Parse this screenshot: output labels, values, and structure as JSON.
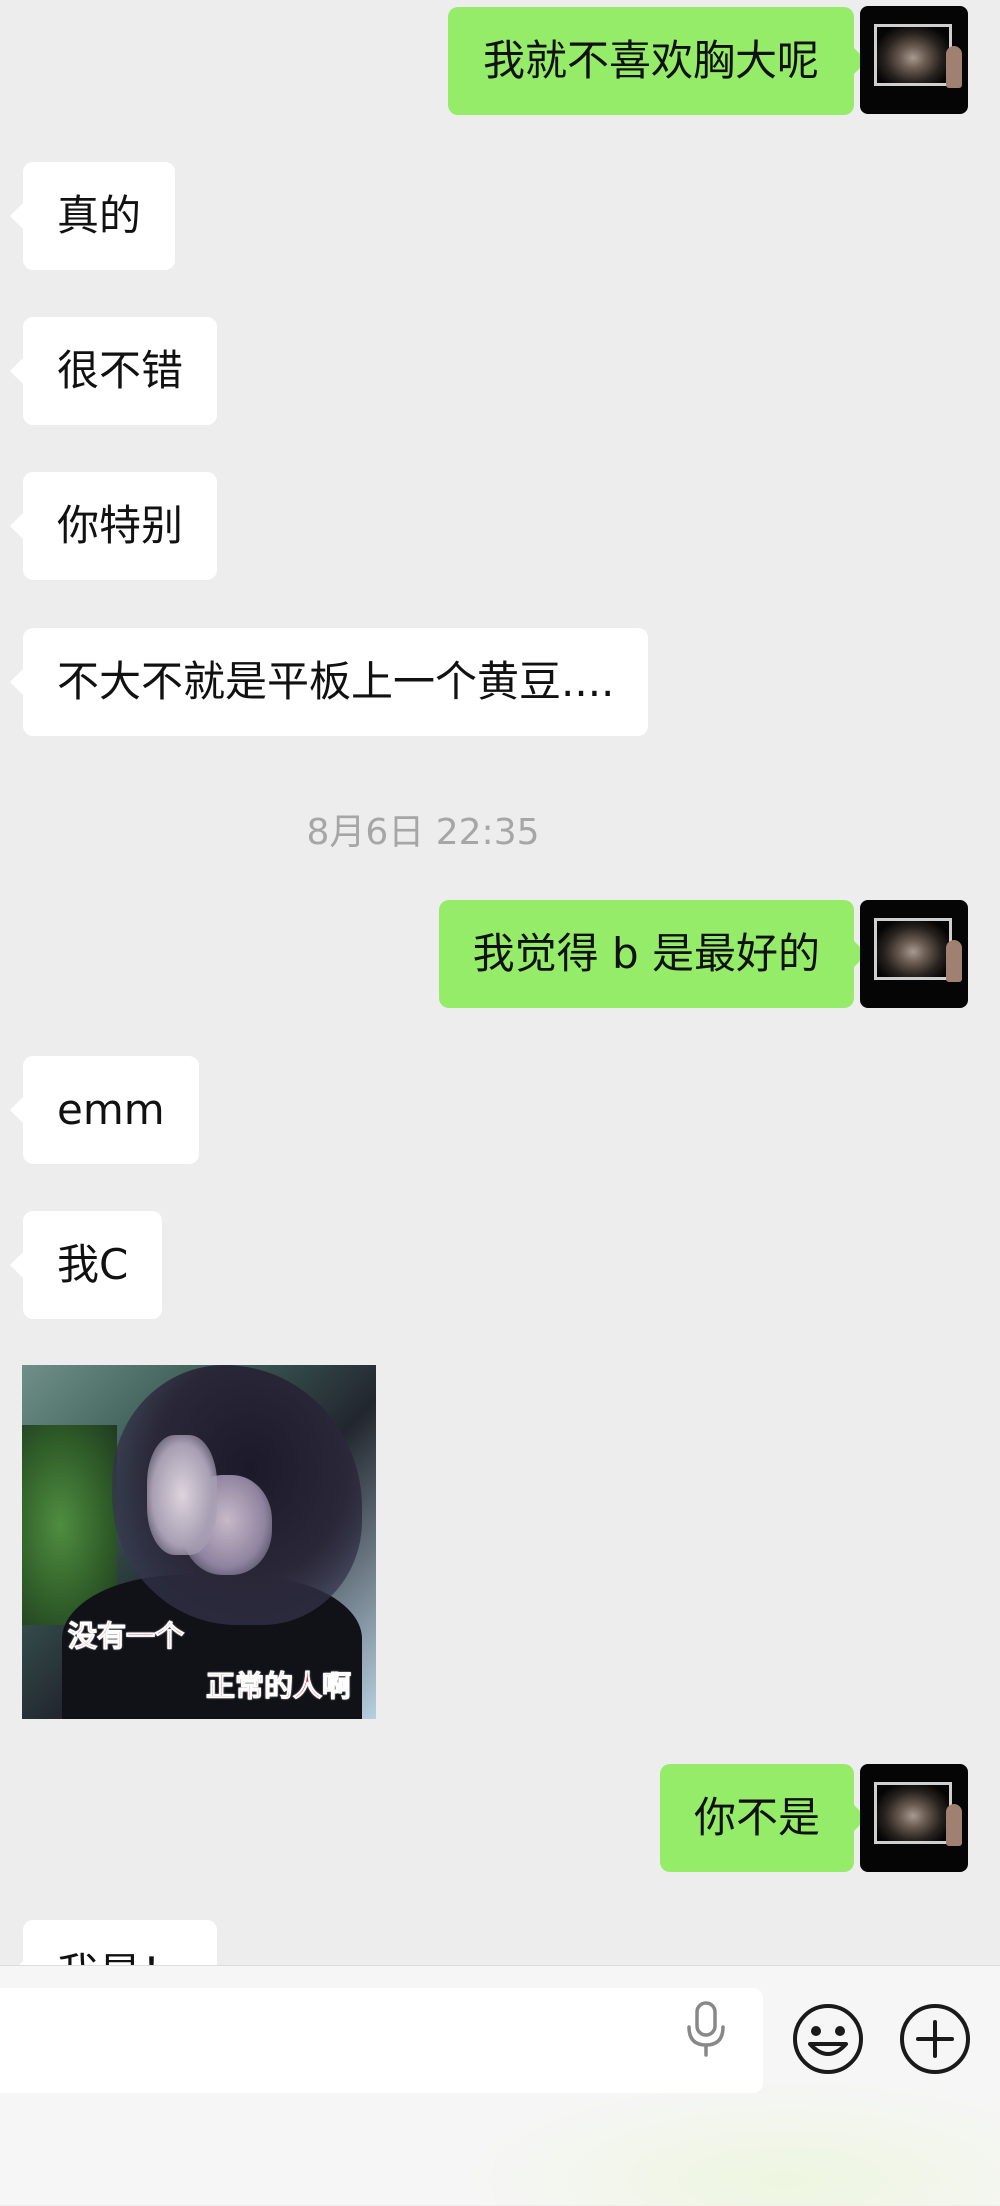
{
  "conversation": {
    "messages": [
      {
        "direction": "sent",
        "text": "我就不喜欢胸大呢"
      },
      {
        "direction": "received",
        "text": "真的"
      },
      {
        "direction": "received",
        "text": "很不错"
      },
      {
        "direction": "received",
        "text": "你特别"
      },
      {
        "direction": "received",
        "text": "不大不就是平板上一个黄豆...."
      },
      {
        "direction": "sent",
        "text": "我觉得 b 是最好的"
      },
      {
        "direction": "received",
        "text": "emm"
      },
      {
        "direction": "received",
        "text": "我C"
      },
      {
        "direction": "sent",
        "text": "你不是"
      },
      {
        "direction": "received",
        "text": "我是！"
      }
    ],
    "timestamp": "8月6日 22:35",
    "image_message": {
      "caption_line1": "没有一个",
      "caption_line2": "正常的人啊"
    }
  },
  "input_bar": {
    "text_value": "",
    "icons": [
      "microphone-icon",
      "emoji-icon",
      "plus-icon"
    ]
  },
  "colors": {
    "background": "#ededed",
    "sent_bubble": "#95ec69",
    "received_bubble": "#ffffff",
    "timestamp_text": "#a6a6a6"
  }
}
